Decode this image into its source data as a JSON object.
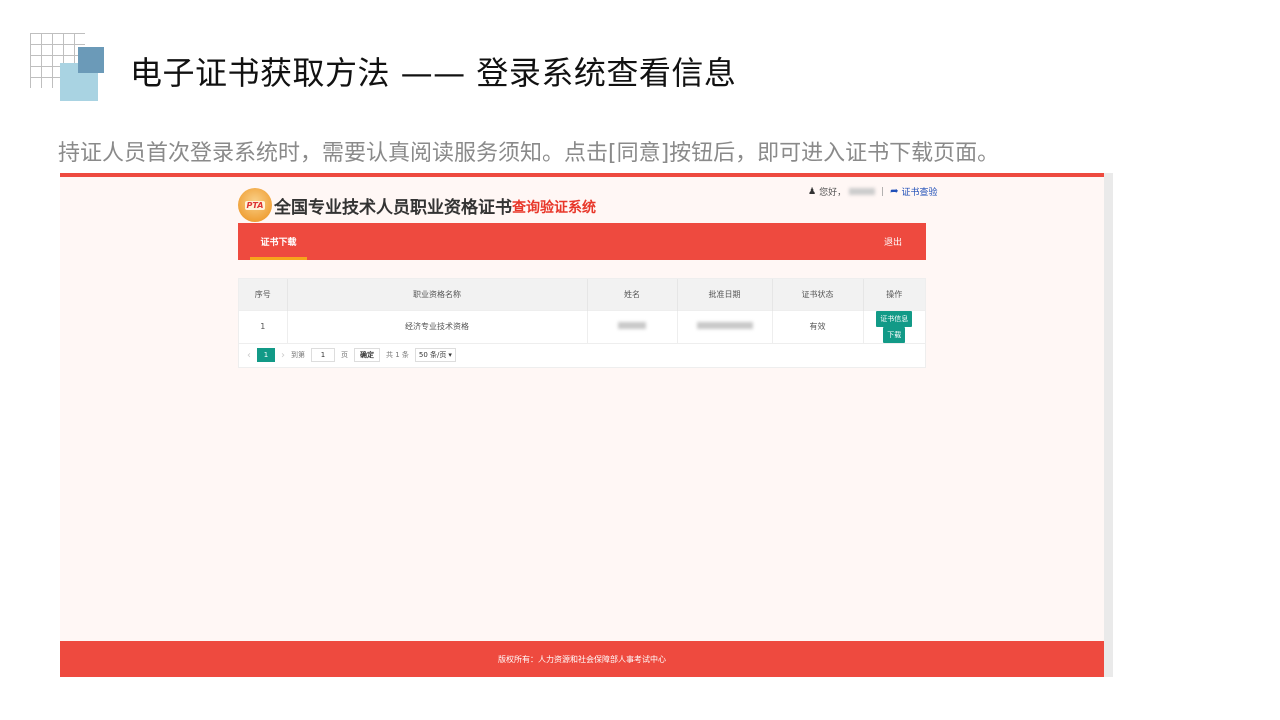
{
  "slide": {
    "title": "电子证书获取方法 —— 登录系统查看信息",
    "description": "持证人员首次登录系统时，需要认真阅读服务须知。点击[同意]按钮后，即可进入证书下载页面。"
  },
  "screenshot": {
    "logo_text": "PTA",
    "system_name": "全国专业技术人员职业资格证书",
    "system_name_red": "查询验证系统",
    "user_bar": {
      "user_icon": "user-icon",
      "greeting": "您好，",
      "separator": "|",
      "share_icon": "share-arrow-icon",
      "link_label": "证书查验"
    },
    "nav": {
      "tab_label": "证书下载",
      "logout_label": "退出"
    },
    "table": {
      "headers": [
        "序号",
        "职业资格名称",
        "姓名",
        "批准日期",
        "证书状态",
        "操作"
      ],
      "rows": [
        {
          "index": "1",
          "qualification": "经济专业技术资格",
          "status": "有效",
          "cert_info_btn": "证书信息",
          "download_btn": "下载"
        }
      ]
    },
    "pager": {
      "prev_icon": "chevron-left-icon",
      "next_icon": "chevron-right-icon",
      "current_page": "1",
      "goto_label": "到第",
      "goto_value": "1",
      "page_unit": "页",
      "ok_label": "确定",
      "total_label": "共 1 条",
      "page_size": "50 条/页"
    },
    "footer": "版权所有：人力资源和社会保障部人事考试中心",
    "colors": {
      "brand_red": "#ee4a3f",
      "green": "#129a87",
      "link_blue": "#1f4fb8",
      "accent_orange": "#f7a41c"
    }
  }
}
